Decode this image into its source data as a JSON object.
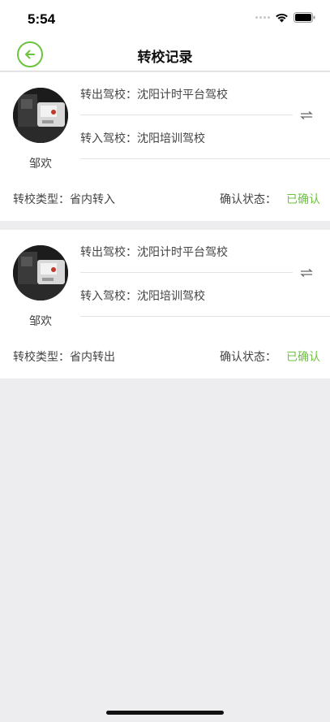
{
  "status_bar": {
    "time": "5:54"
  },
  "header": {
    "title": "转校记录"
  },
  "records": [
    {
      "name": "邹欢",
      "from_label": "转出驾校：",
      "from_school": "沈阳计时平台驾校",
      "to_label": "转入驾校：",
      "to_school": "沈阳培训驾校",
      "type_label": "转校类型：",
      "type_value": "省内转入",
      "status_label": "确认状态：",
      "status_value": "已确认"
    },
    {
      "name": "邹欢",
      "from_label": "转出驾校：",
      "from_school": "沈阳计时平台驾校",
      "to_label": "转入驾校：",
      "to_school": "沈阳培训驾校",
      "type_label": "转校类型：",
      "type_value": "省内转出",
      "status_label": "确认状态：",
      "status_value": "已确认"
    }
  ],
  "colors": {
    "accent": "#6cc43e",
    "background": "#ededf0",
    "card": "#ffffff"
  }
}
